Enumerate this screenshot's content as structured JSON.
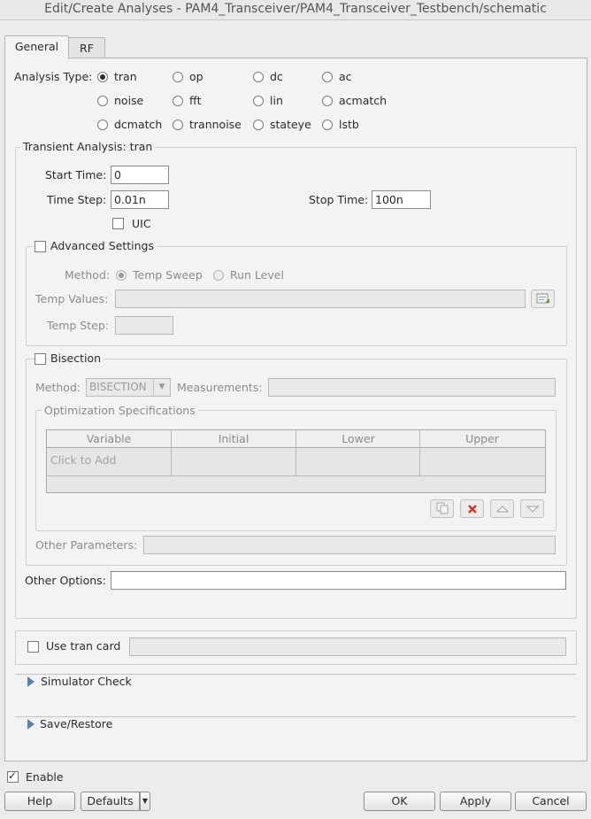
{
  "window": {
    "title": "Edit/Create Analyses - PAM4_Transceiver/PAM4_Transceiver_Testbench/schematic"
  },
  "tabs": [
    {
      "label": "General"
    },
    {
      "label": "RF"
    }
  ],
  "analysis_type": {
    "label": "Analysis Type:",
    "selected": "tran",
    "options": [
      "tran",
      "op",
      "dc",
      "ac",
      "noise",
      "fft",
      "lin",
      "acmatch",
      "dcmatch",
      "trannoise",
      "stateye",
      "lstb"
    ]
  },
  "transient": {
    "group_title": "Transient Analysis: tran",
    "start_time_label": "Start Time:",
    "start_time": "0",
    "time_step_label": "Time Step:",
    "time_step": "0.01n",
    "stop_time_label": "Stop Time:",
    "stop_time": "100n",
    "uic_label": "UIC"
  },
  "advanced": {
    "label": "Advanced Settings",
    "method_label": "Method:",
    "method_options": [
      "Temp Sweep",
      "Run Level"
    ],
    "method_selected": "Temp Sweep",
    "temp_values_label": "Temp Values:",
    "temp_step_label": "Temp Step:"
  },
  "bisection": {
    "label": "Bisection",
    "method_label": "Method:",
    "method_value": "BISECTION",
    "measurements_label": "Measurements:",
    "opt_specs_title": "Optimization Specifications",
    "columns": [
      "Variable",
      "Initial",
      "Lower",
      "Upper"
    ],
    "add_row_placeholder": "Click to Add",
    "other_params_label": "Other Parameters:"
  },
  "other_options_label": "Other Options:",
  "tran_card_label": "Use tran card",
  "sections": {
    "simulator_check": "Simulator Check",
    "save_restore": "Save/Restore"
  },
  "enable_label": "Enable",
  "buttons": {
    "help": "Help",
    "defaults": "Defaults",
    "ok": "OK",
    "apply": "Apply",
    "cancel": "Cancel"
  },
  "icons": {
    "browse": "file-browse-icon",
    "copy": "copy-icon",
    "delete": "delete-icon",
    "up": "arrow-up-icon",
    "down": "arrow-down-icon",
    "expand": "expand-triangle-icon"
  },
  "colors": {
    "delete_red": "#d03a2b",
    "expand_blue": "#5b7fb0"
  }
}
